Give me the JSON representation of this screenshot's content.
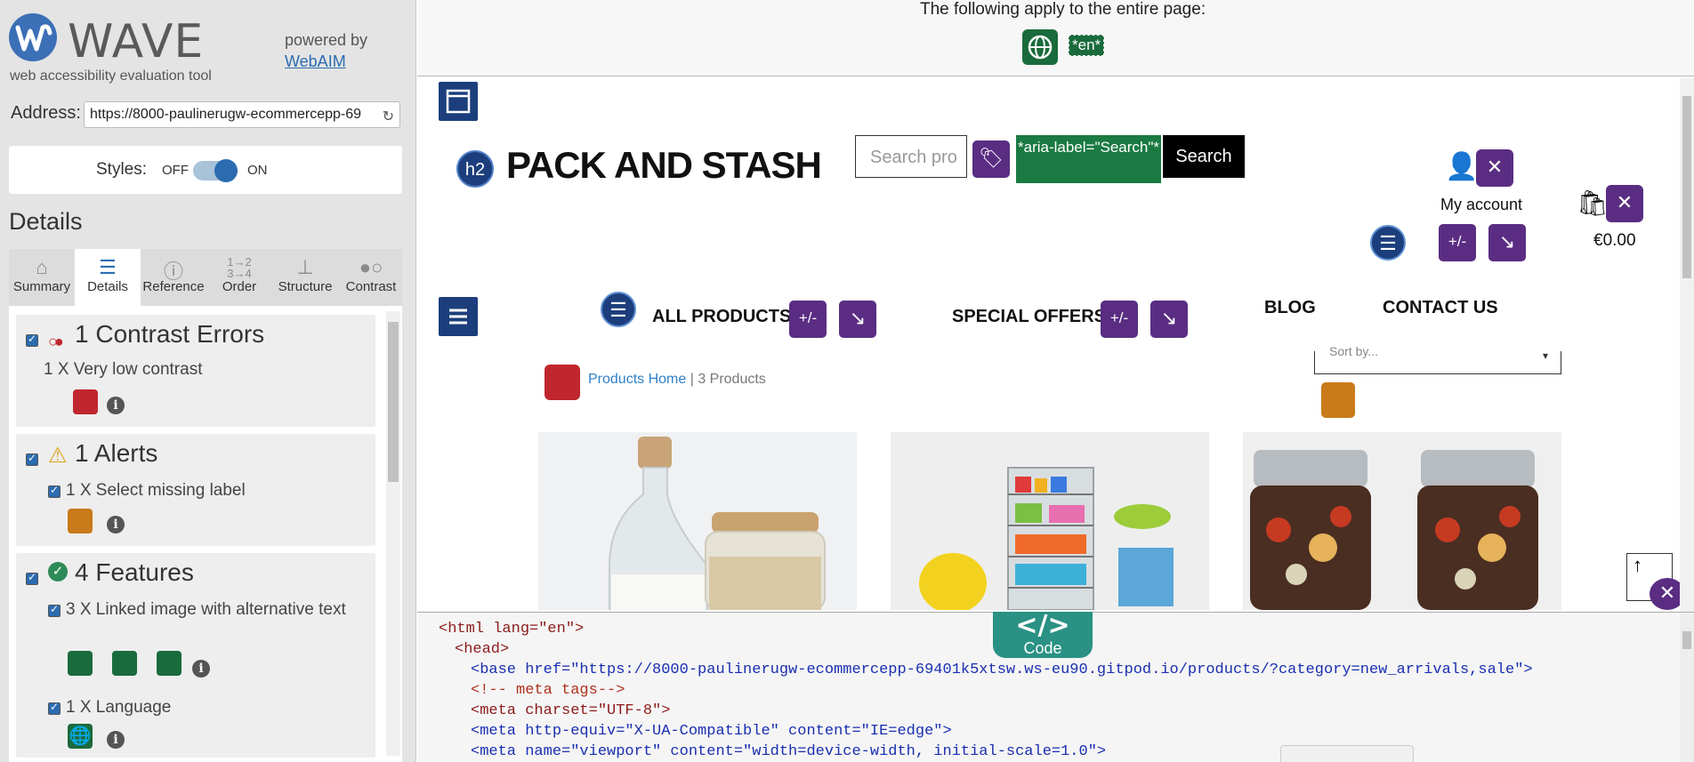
{
  "sidebar": {
    "wave_title": "WAVE",
    "wave_subtitle": "web accessibility evaluation tool",
    "powered_by": "powered by",
    "webaim_link": "WebAIM",
    "address_label": "Address:",
    "address_value": "https://8000-paulinerugw-ecommercepp-69",
    "styles_label": "Styles:",
    "styles_off": "OFF",
    "styles_on": "ON",
    "details_heading": "Details",
    "tabs": [
      {
        "label": "Summary",
        "icon": "home-icon"
      },
      {
        "label": "Details",
        "icon": "list-icon"
      },
      {
        "label": "Reference",
        "icon": "info-icon"
      },
      {
        "label": "Order",
        "icon": "order-icon"
      },
      {
        "label": "Structure",
        "icon": "structure-icon"
      },
      {
        "label": "Contrast",
        "icon": "contrast-icon"
      }
    ],
    "sections": [
      {
        "title": "1 Contrast Errors",
        "items": [
          "1 X Very low contrast"
        ]
      },
      {
        "title": "1 Alerts",
        "items": [
          "1 X Select missing label"
        ]
      },
      {
        "title": "4 Features",
        "items": [
          "3 X Linked image with alternative text",
          "1 X Language"
        ]
      }
    ]
  },
  "page": {
    "entire_page_text": "The following apply to the entire page:",
    "lang_tag": "*en*",
    "brand": "PACK AND STASH",
    "h2_label": "h2",
    "search_placeholder": "Search pro",
    "aria_label_tag": "*aria-label=\"Search\"*",
    "search_button": "Search",
    "my_account": "My account",
    "cart_total": "€0.00",
    "nav": [
      "ALL PRODUCTS",
      "SPECIAL OFFERS",
      "BLOG",
      "CONTACT US"
    ],
    "breadcrumb_link": "Products Home",
    "breadcrumb_sep": " | ",
    "breadcrumb_count": "3 Products",
    "sort_placeholder": "Sort by...",
    "plus_minus": "+/-"
  },
  "code": {
    "button_symbol": "</>",
    "button_label": "Code",
    "lines": [
      "<html lang=\"en\">",
      "<head>",
      "<base href=\"https://8000-paulinerugw-ecommercepp-69401k5xtsw.ws-eu90.gitpod.io/products/?category=new_arrivals,sale\">",
      "<!-- meta tags-->",
      "<meta charset=\"UTF-8\">",
      "<meta http-equiv=\"X-UA-Compatible\" content=\"IE=edge\">",
      "<meta name=\"viewport\" content=\"width=device-width, initial-scale=1.0\">"
    ]
  },
  "colors": {
    "wave_blue": "#2b6cb0",
    "feature_green": "#1a6b3c",
    "error_red": "#c0262d",
    "alert_orange": "#c97a1a",
    "aria_purple": "#5a2d82",
    "structure_navy": "#1c3e7c",
    "code_teal": "#2a9184"
  }
}
